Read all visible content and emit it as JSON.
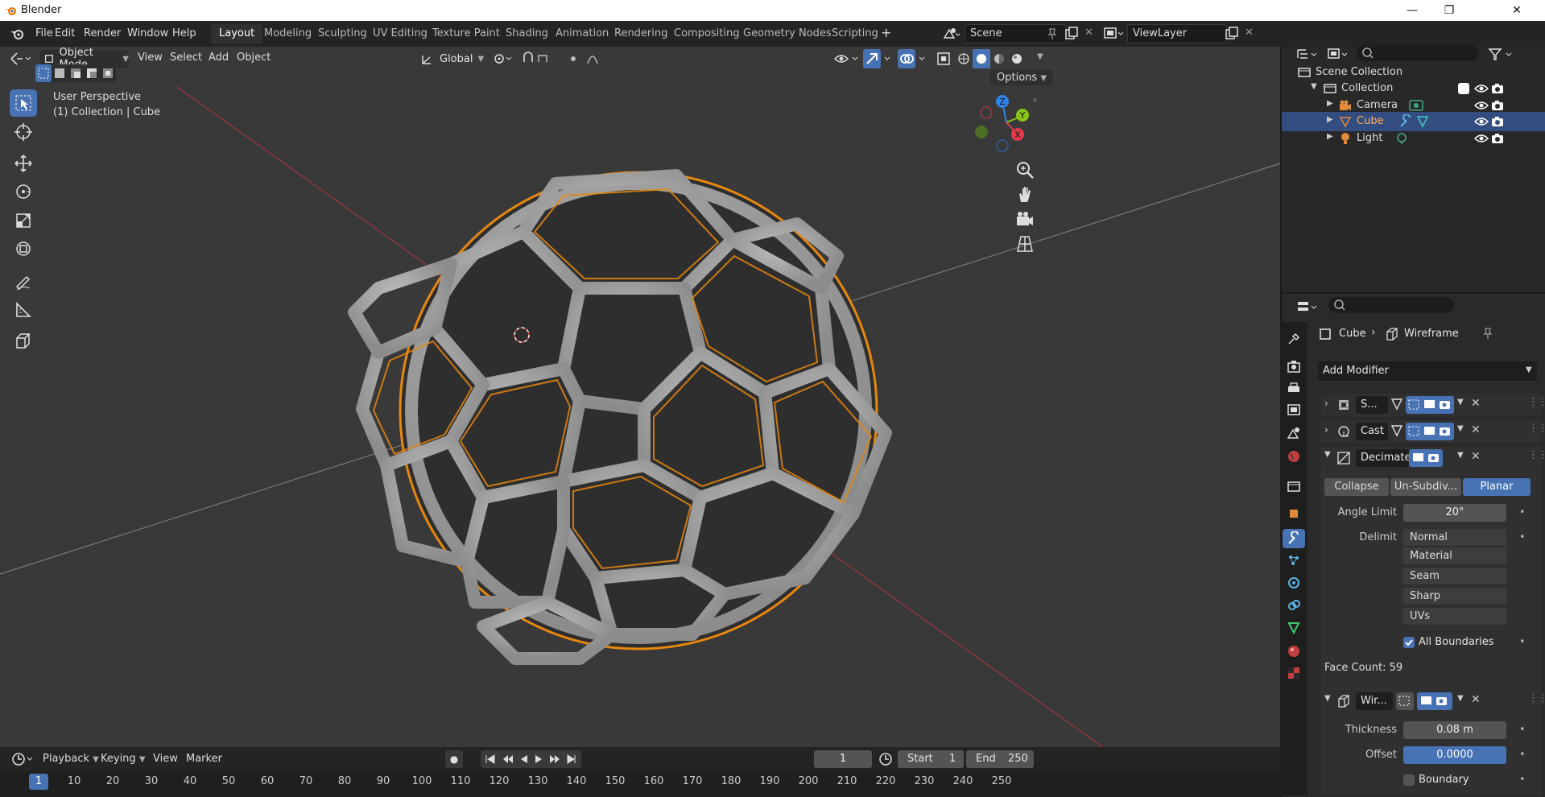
{
  "window": {
    "title": "Blender",
    "minimize": "—",
    "maximize": "❐",
    "close": "✕"
  },
  "menus": [
    "File",
    "Edit",
    "Render",
    "Window",
    "Help"
  ],
  "workspaces": [
    "Layout",
    "Modeling",
    "Sculpting",
    "UV Editing",
    "Texture Paint",
    "Shading",
    "Animation",
    "Rendering",
    "Compositing",
    "Geometry Nodes",
    "Scripting"
  ],
  "workspace_add": "+",
  "scene": {
    "name": "Scene"
  },
  "view_layer": {
    "name": "ViewLayer"
  },
  "viewport_header": {
    "mode": "Object Mode",
    "menus": [
      "View",
      "Select",
      "Add",
      "Object"
    ],
    "transform_orientation": "Global",
    "options": "Options"
  },
  "viewport_overlay": {
    "line1": "User Perspective",
    "line2": "(1) Collection | Cube"
  },
  "gizmo": {
    "x": "X",
    "y": "Y",
    "z": "Z"
  },
  "outliner": {
    "root": "Scene Collection",
    "collection": "Collection",
    "objects": [
      "Camera",
      "Cube",
      "Light"
    ],
    "selected": "Cube"
  },
  "properties": {
    "breadcrumb_object": "Cube",
    "breadcrumb_modifier": "Wireframe",
    "add_modifier": "Add Modifier",
    "modifiers": [
      {
        "name": "S...",
        "expanded": false
      },
      {
        "name": "Cast",
        "expanded": false
      },
      {
        "name": "Decimate",
        "expanded": true
      },
      {
        "name": "Wir...",
        "expanded": true
      }
    ],
    "decimate": {
      "modes": [
        "Collapse",
        "Un-Subdiv...",
        "Planar"
      ],
      "active_mode": "Planar",
      "angle_limit_label": "Angle Limit",
      "angle_limit": "20°",
      "delimit_label": "Delimit",
      "delimit_options": [
        "Normal",
        "Material",
        "Seam",
        "Sharp",
        "UVs"
      ],
      "all_boundaries_label": "All Boundaries",
      "all_boundaries": true,
      "face_count": "Face Count: 59"
    },
    "wireframe": {
      "thickness_label": "Thickness",
      "thickness": "0.08 m",
      "offset_label": "Offset",
      "offset": "0.0000",
      "boundary_label": "Boundary"
    }
  },
  "timeline": {
    "menus": [
      "Playback",
      "Keying",
      "View",
      "Marker"
    ],
    "current_frame": "1",
    "start_label": "Start",
    "start": "1",
    "end_label": "End",
    "end": "250",
    "ruler": [
      "1",
      "10",
      "20",
      "30",
      "40",
      "50",
      "60",
      "70",
      "80",
      "90",
      "100",
      "110",
      "120",
      "130",
      "140",
      "150",
      "160",
      "170",
      "180",
      "190",
      "200",
      "210",
      "220",
      "230",
      "240",
      "250"
    ]
  },
  "colors": {
    "accent": "#4772b3",
    "selection_outline": "#e8870e",
    "axis_x": "#e03c4c",
    "axis_y": "#8ac416",
    "axis_z": "#2f83e8"
  }
}
